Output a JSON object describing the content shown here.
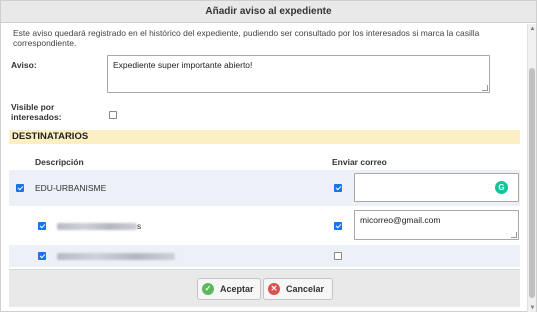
{
  "dialog": {
    "title": "Añadir aviso al expediente",
    "info": "Este aviso quedará registrado en el histórico del expediente, pudiendo ser consultado por los interesados si marca la casilla correspondiente."
  },
  "form": {
    "aviso_label": "Aviso:",
    "aviso_value": "Expediente super importante abierto!",
    "visible_label_line1": "Visible por",
    "visible_label_line2": "interesados:",
    "visible_checked": false
  },
  "destinatarios": {
    "section_title": "DESTINATARIOS",
    "col_descripcion": "Descripción",
    "col_enviar": "Enviar correo",
    "rows": [
      {
        "name": "EDU-URBANISME",
        "selected": true,
        "send_email": true,
        "email": "",
        "blurred": false
      },
      {
        "name": "",
        "selected": true,
        "send_email": true,
        "email": "micorreo@gmail.com",
        "blurred": true,
        "suffix": "s"
      },
      {
        "name": "",
        "selected": true,
        "send_email": false,
        "email": "",
        "blurred": true
      }
    ]
  },
  "buttons": {
    "accept_label": "Aceptar",
    "cancel_label": "Cancelar"
  },
  "icons": {
    "accept": "check-circle-icon",
    "cancel": "cancel-circle-icon",
    "grammarly": "grammarly-icon"
  },
  "colors": {
    "section_bg": "#fcefc4",
    "row_bg": "#eef0f8",
    "checkbox": "#1a73e8",
    "accept_icon": "#5cb85c",
    "cancel_icon": "#d9534f",
    "grammarly": "#15c39a"
  }
}
